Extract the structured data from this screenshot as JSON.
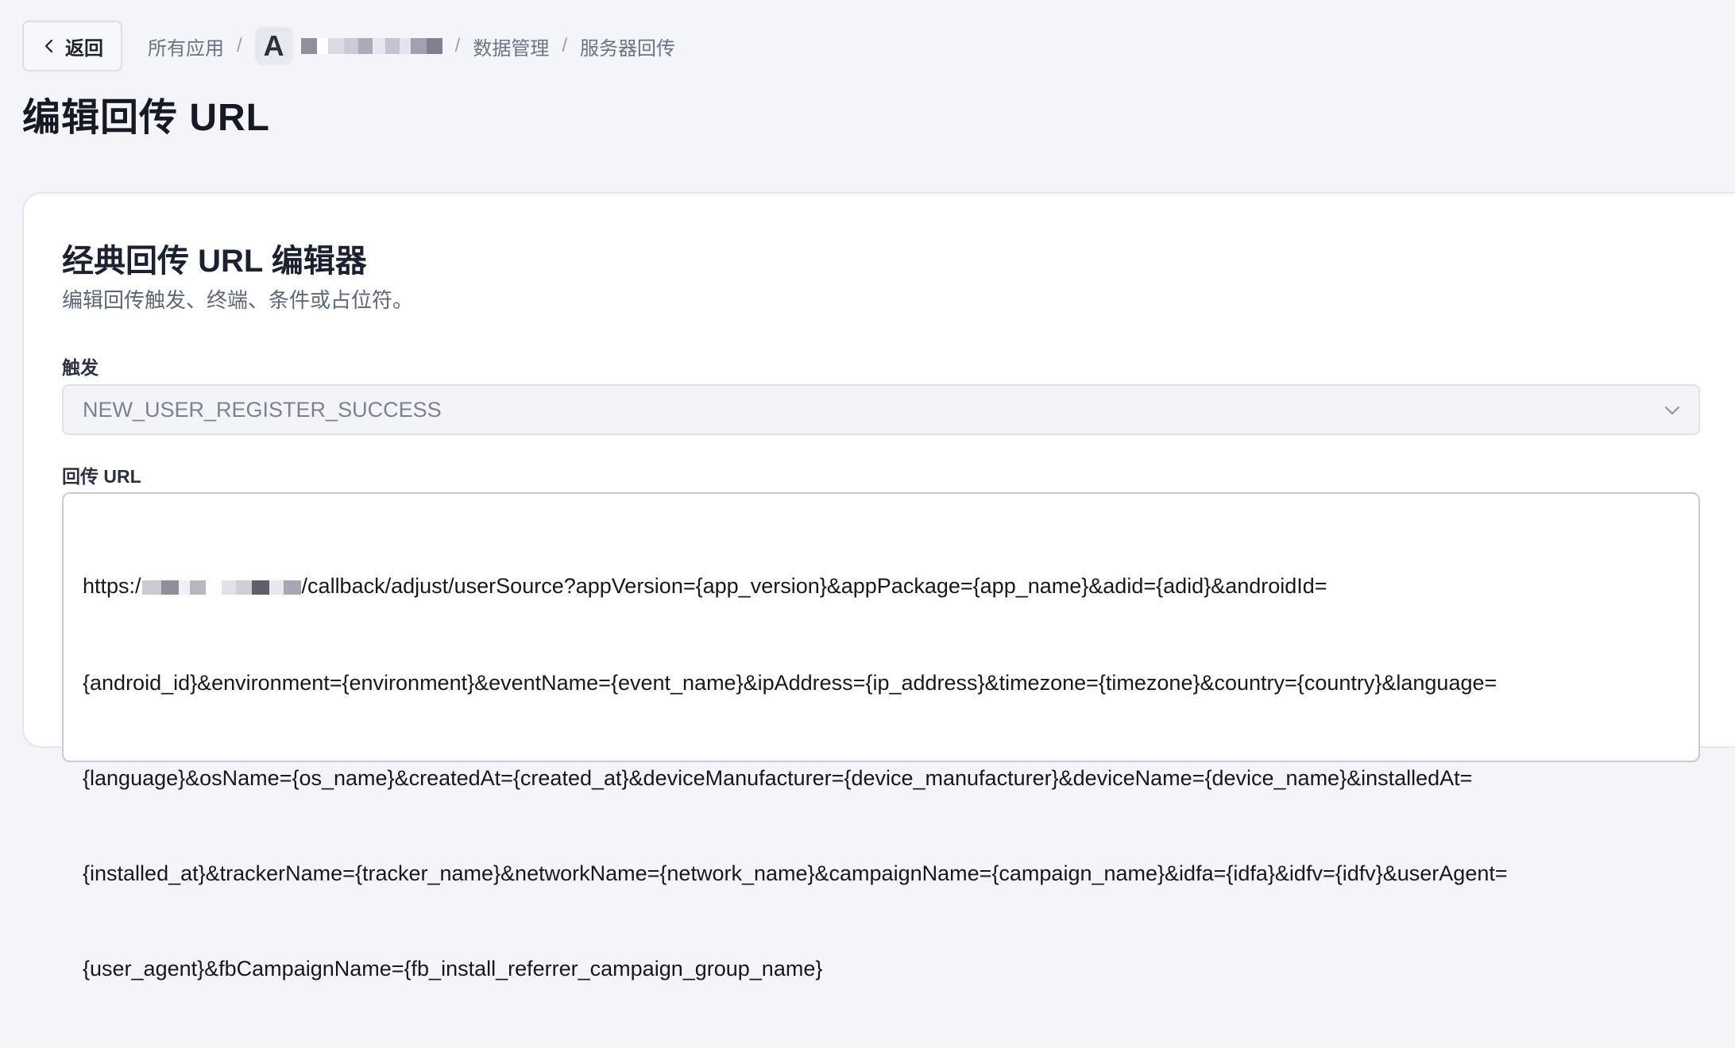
{
  "header": {
    "back_label": "返回",
    "breadcrumb": {
      "all_apps": "所有应用",
      "app_initial": "A",
      "data_management": "数据管理",
      "server_postback": "服务器回传",
      "separator": "/"
    }
  },
  "page": {
    "title": "编辑回传 URL"
  },
  "editor": {
    "title": "经典回传 URL 编辑器",
    "subtitle": "编辑回传触发、终端、条件或占位符。",
    "trigger_label": "触发",
    "trigger_value": "NEW_USER_REGISTER_SUCCESS",
    "url_label": "回传 URL",
    "url_lines": [
      "https:/",
      "/callback/adjust/userSource?appVersion={app_version}&appPackage={app_name}&adid={adid}&androidId=",
      "{android_id}&environment={environment}&eventName={event_name}&ipAddress={ip_address}&timezone={timezone}&country={country}&language=",
      "{language}&osName={os_name}&createdAt={created_at}&deviceManufacturer={device_manufacturer}&deviceName={device_name}&installedAt=",
      "{installed_at}&trackerName={tracker_name}&networkName={network_name}&campaignName={campaign_name}&idfa={idfa}&idfv={idfv}&userAgent=",
      "{user_agent}&fbCampaignName={fb_install_referrer_campaign_group_name}"
    ]
  },
  "icons": {
    "back": "chevron-left-icon",
    "select": "chevron-down-icon"
  },
  "colors": {
    "background": "#f4f5f8",
    "card": "#ffffff",
    "title": "#151a24",
    "muted": "#6b7386"
  }
}
